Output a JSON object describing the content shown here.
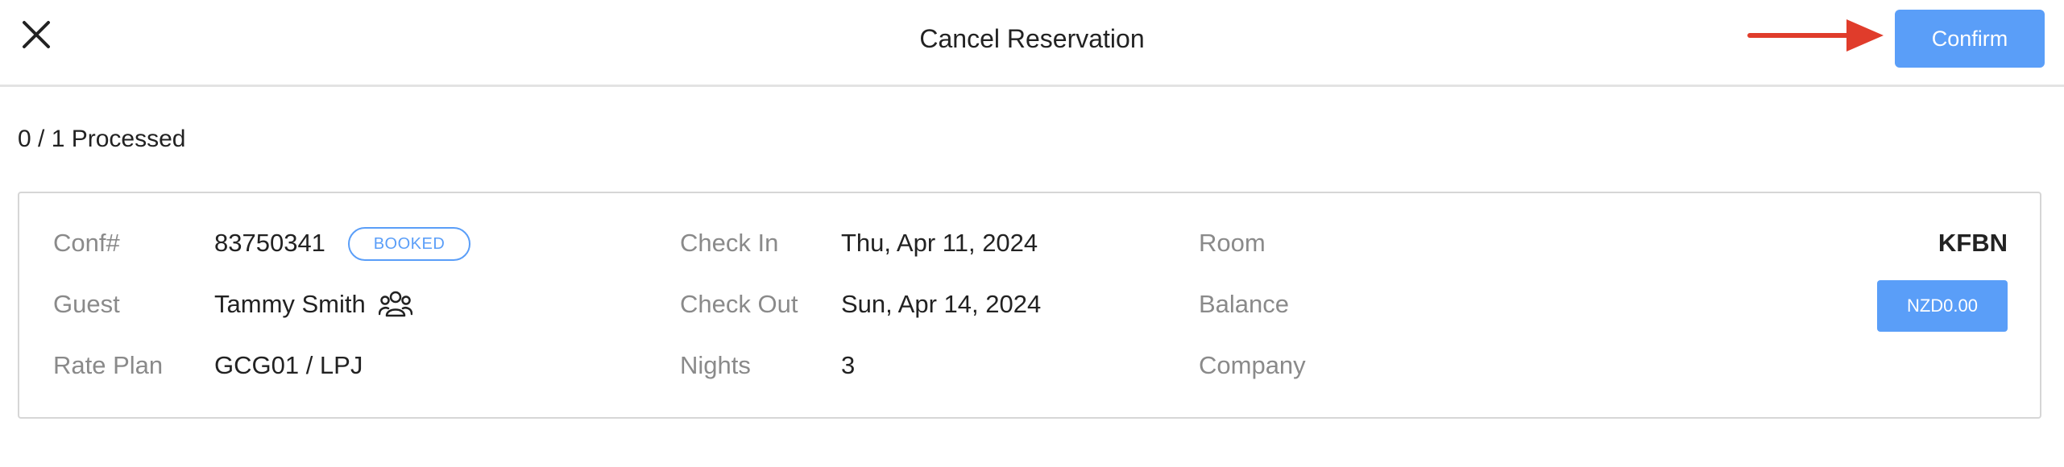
{
  "header": {
    "title": "Cancel Reservation",
    "close_icon": "close-icon",
    "confirm_label": "Confirm",
    "arrow_color": "#e03c2b"
  },
  "progress": {
    "text": "0 / 1 Processed"
  },
  "reservation": {
    "conf_label": "Conf#",
    "conf_value": "83750341",
    "status_badge": "BOOKED",
    "guest_label": "Guest",
    "guest_value": "Tammy Smith",
    "guest_icon": "group-icon",
    "rate_plan_label": "Rate Plan",
    "rate_plan_value": "GCG01 / LPJ",
    "check_in_label": "Check In",
    "check_in_value": "Thu, Apr 11, 2024",
    "check_out_label": "Check Out",
    "check_out_value": "Sun, Apr 14, 2024",
    "nights_label": "Nights",
    "nights_value": "3",
    "room_label": "Room",
    "room_value": "KFBN",
    "balance_label": "Balance",
    "balance_value": "NZD0.00",
    "company_label": "Company",
    "company_value": ""
  },
  "colors": {
    "accent": "#5a9ef8",
    "label_gray": "#8a8a8a",
    "border": "#d6d6d6"
  }
}
